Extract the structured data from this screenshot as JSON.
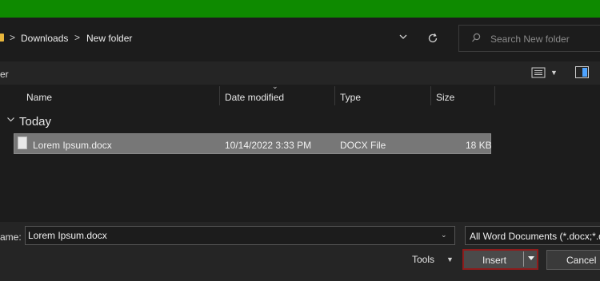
{
  "breadcrumb": {
    "items": [
      "Downloads",
      "New folder"
    ],
    "separator": ">"
  },
  "search": {
    "placeholder": "Search New folder"
  },
  "toolbar": {
    "label": "er"
  },
  "columns": [
    {
      "label": "Name"
    },
    {
      "label": "Date modified"
    },
    {
      "label": "Type"
    },
    {
      "label": "Size"
    }
  ],
  "groups": [
    {
      "label": "Today",
      "files": [
        {
          "name": "Lorem Ipsum.docx",
          "date_modified": "10/14/2022 3:33 PM",
          "type": "DOCX File",
          "size": "18 KB"
        }
      ]
    }
  ],
  "footer": {
    "file_name_label": "ame:",
    "file_name_value": "Lorem Ipsum.docx",
    "file_type": "All Word Documents (*.docx;*.d",
    "tools_label": "Tools",
    "insert_label": "Insert",
    "cancel_label": "Cancel"
  },
  "colors": {
    "title_bar": "#0e8a00",
    "background": "#1c1c1c",
    "panel": "#252525",
    "selected_row": "#777777",
    "insert_outline": "#8e1c1c",
    "folder": "#e8b63c",
    "accent": "#4ea3ff"
  }
}
